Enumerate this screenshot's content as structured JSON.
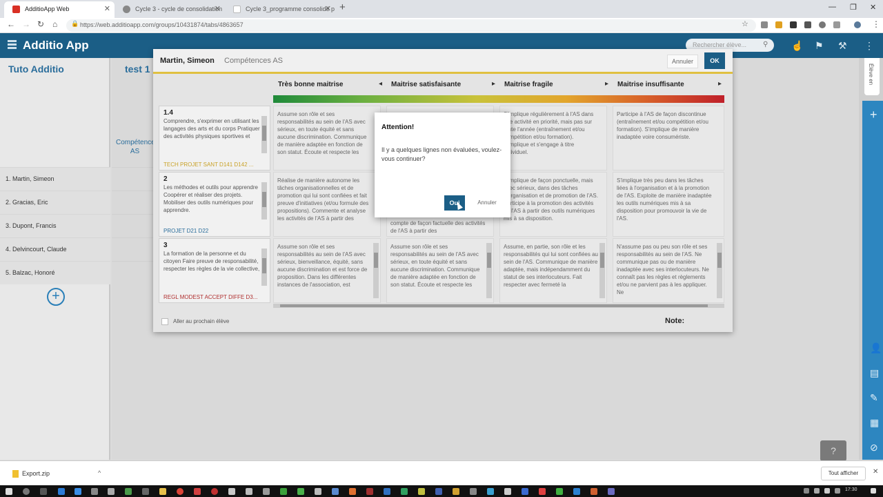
{
  "browser": {
    "tabs": [
      {
        "title": "AdditioApp Web",
        "color": "#d93025"
      },
      {
        "title": "Cycle 3 - cycle de consolidation",
        "color": "#888888"
      },
      {
        "title": "Cycle 3_programme consolidé p",
        "color": "#dddddd"
      }
    ],
    "url": "https://web.additioapp.com/groups/10431874/tabs/4863657"
  },
  "app": {
    "title": "Additio App",
    "search_placeholder": "Rechercher élève...",
    "accent": "#1b5e86"
  },
  "sidebar": {
    "group_title": "Tuto Additio",
    "students": [
      "1. Martin, Simeon",
      "2. Gracias, Eric",
      "3. Dupont, Francis",
      "4. Delvincourt, Claude",
      "5. Balzac, Honoré"
    ]
  },
  "main": {
    "tab_title": "test 1",
    "column_label": "Compétences AS"
  },
  "right_panel": {
    "tab_label": "Élève en"
  },
  "modal": {
    "student": "Martin, Simeon",
    "rubric": "Compétences AS",
    "cancel_label": "Annuler",
    "ok_label": "OK",
    "levels": [
      "Très bonne maitrise",
      "Maitrise satisfaisante",
      "Maitrise fragile",
      "Maitrise insuffisante"
    ],
    "criteria": [
      {
        "num": "1.4",
        "text": "Comprendre, s'exprimer en utilisant les langages des arts et du corps Pratiquer des activités physiques sportives et",
        "tags": "TECH  PROJET  SANT  D141  D142 ..."
      },
      {
        "num": "2",
        "text": "Les méthodes et outils pour apprendre Coopérer et réaliser des projets. Mobiliser des outils numériques pour apprendre.",
        "tags": "PROJET  D21  D22"
      },
      {
        "num": "3",
        "text": "La formation de la personne et du citoyen Faire preuve de responsabilité, respecter les règles de la vie collective,",
        "tags": "REGL  MODEST  ACCEPT  DIFFE  D3..."
      }
    ],
    "cells": [
      [
        "Assume son rôle et ses responsabilités au sein de l'AS avec sérieux, en toute équité et sans aucune discrimination. Communique de manière adaptée en fonction de son statut. Écoute et respecte les",
        "",
        "S'implique régulièrement à l'AS dans une activité en priorité, mais pas sur toute l'année (entraînement et/ou compétition et/ou formation). S'implique et s'engage à titre individuel.",
        "Participe à l'AS de façon discontinue (entraînement et/ou compétition et/ou formation). S'implique de manière inadaptée voire consumériste."
      ],
      [
        "Réalise de manière autonome les tâches organisationnelles et de promotion qui lui sont confiées et fait preuve d'initiatives (et/ou formule des propositions). Commente et analyse les activités de l'AS à partir des",
        "compte de façon factuelle des activités de l'AS à partir des",
        "S'implique de façon ponctuelle, mais avec sérieux, dans des tâches d'organisation et de promotion de l'AS. Participe à la promotion des activités de l'AS à partir des outils numériques mis à sa disposition.",
        "S'implique très peu dans les tâches liées à l'organisation et à la promotion de l'AS. Exploite de manière inadaptée les outils numériques mis à sa disposition pour promouvoir la vie de l'AS."
      ],
      [
        "Assume son rôle et ses responsabilités au sein de l'AS avec sérieux, bienveillance, équité, sans aucune discrimination et est force de proposition. Dans les différentes instances de l'association, est",
        "Assume son rôle et ses responsabilités au sein de l'AS avec sérieux, en toute équité et sans aucune discrimination. Communique de manière adaptée en fonction de son statut. Écoute et respecte les",
        "Assume, en partie, son rôle et les responsabilités qui lui sont confiées au sein de l'AS. Communique de manière adaptée, mais indépendamment du statut de ses interlocuteurs. Fait respecter avec fermeté la",
        "N'assume pas ou peu son rôle et ses responsabilités au sein de l'AS. Ne communique pas ou de manière inadaptée avec ses interlocuteurs. Ne connaît pas les règles et règlements et/ou ne parvient pas à les appliquer. Ne"
      ]
    ],
    "next_student_label": "Aller au prochain élève",
    "note_label": "Note:"
  },
  "alert": {
    "title": "Attention!",
    "message": "Il y a quelques lignes non évaluées, voulez-vous continuer?",
    "yes_label": "Oui",
    "no_label": "Annuler"
  },
  "download": {
    "file": "Export.zip",
    "show_all": "Tout afficher"
  },
  "taskbar": {
    "time": "17:30"
  }
}
